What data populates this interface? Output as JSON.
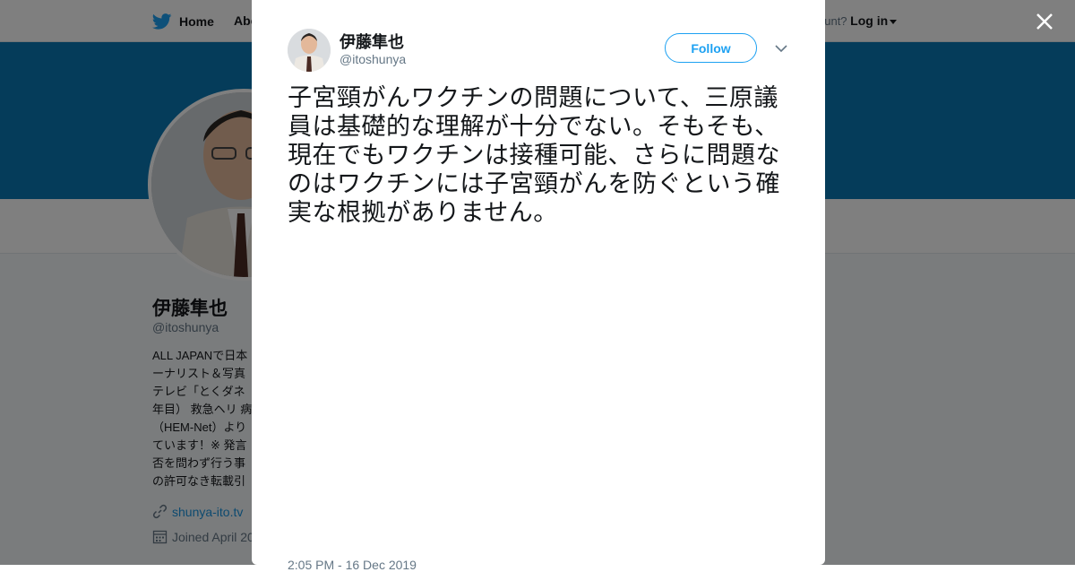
{
  "nav": {
    "home_label": "Home",
    "about_label": "Abo",
    "account_prompt": "ccount?",
    "login_label": "Log in"
  },
  "profile": {
    "name": "伊藤隼也",
    "handle": "@itoshunya",
    "bio_lines": [
      "ALL JAPANで日本",
      "ーナリスト＆写真",
      "テレビ「とくダネ",
      "年目） 救急ヘリ 病",
      "（HEM-Net）より",
      "ています！※ 発言",
      "否を問わず行う事",
      "の許可なき転載引"
    ],
    "website": "shunya-ito.tv",
    "joined": "Joined April 20"
  },
  "tweet": {
    "author_name": "伊藤隼也",
    "author_handle": "@itoshunya",
    "follow_label": "Follow",
    "text": "子宮頸がんワクチンの問題について、三原議員は基礎的な理解が十分でない。そもそも、現在でもワクチンは接種可能、さらに問題なのはワクチンには子宮頸がんを防ぐという確実な根拠がありません。",
    "timestamp": "2:05 PM - 16 Dec 2019"
  },
  "colors": {
    "brand_blue": "#1da1f2",
    "banner": "#0a78b5",
    "overlay": "rgba(0,0,0,0.5)"
  },
  "icons": [
    "twitter-bird-icon",
    "link-icon",
    "calendar-icon",
    "close-icon",
    "chevron-down-icon",
    "caret-down-icon"
  ]
}
